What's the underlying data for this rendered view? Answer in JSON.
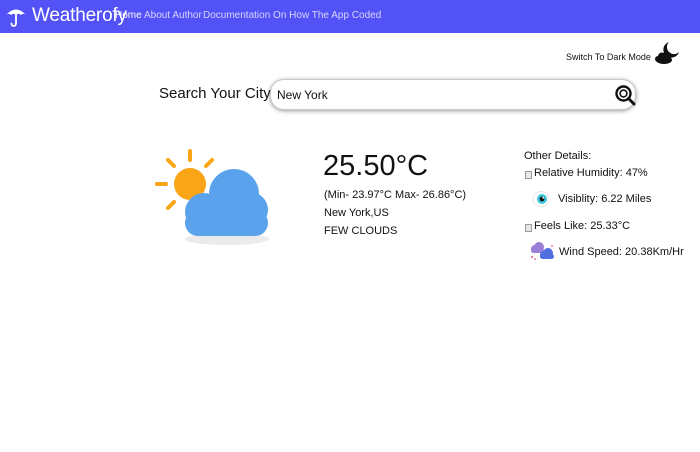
{
  "navbar": {
    "brand": "Weatherofy",
    "links": [
      {
        "label": "Home",
        "active": true
      },
      {
        "label": "About Author",
        "active": false
      },
      {
        "label": "Documentation On How The App Coded",
        "active": false
      }
    ],
    "bg_color": "#5352f6"
  },
  "theme_toggle": {
    "label": "Switch To Dark Mode",
    "icon": "moon-cloud-icon"
  },
  "search": {
    "label": "Search Your City:",
    "value": "New York",
    "icon": "search-icon"
  },
  "weather": {
    "icon": "sun-behind-cloud-icon",
    "temperature": "25.50°C",
    "min_max": "(Min- 23.97°C Max- 26.86°C)",
    "location": "New York,US",
    "description": "FEW CLOUDS"
  },
  "details": {
    "title": "Other Details:",
    "humidity": "Relative Humidity: 47%",
    "visibility": "Visiblity: 6.22 Miles",
    "feels_like": "Feels Like: 25.33°C",
    "wind_speed": "Wind Speed: 20.38Km/Hr"
  }
}
